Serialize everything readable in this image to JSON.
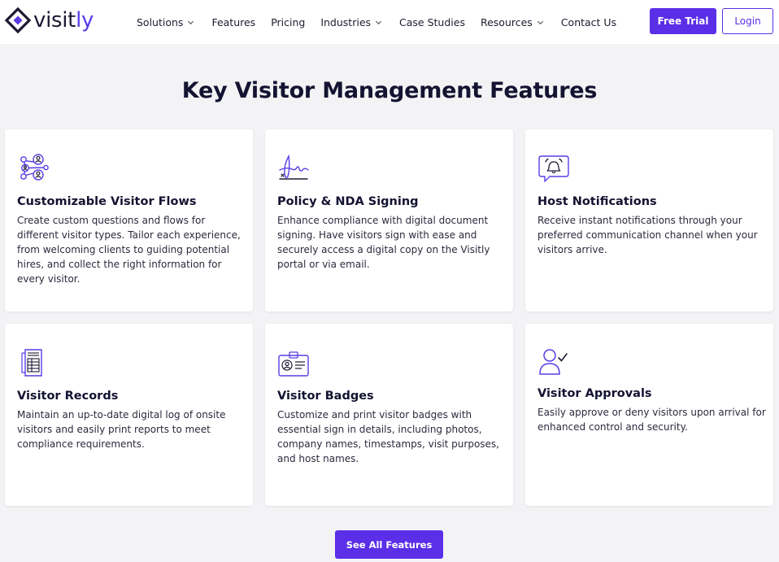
{
  "brand": {
    "name_prefix": "visit",
    "name_accent": "ly",
    "accent_color": "#5b2ee8",
    "dark_color": "#1b1a33"
  },
  "nav": {
    "items": [
      {
        "label": "Solutions",
        "has_dropdown": true
      },
      {
        "label": "Features",
        "has_dropdown": false
      },
      {
        "label": "Pricing",
        "has_dropdown": false
      },
      {
        "label": "Industries",
        "has_dropdown": true
      },
      {
        "label": "Case Studies",
        "has_dropdown": false
      },
      {
        "label": "Resources",
        "has_dropdown": true
      },
      {
        "label": "Contact Us",
        "has_dropdown": false
      }
    ],
    "free_trial_label": "Free Trial",
    "login_label": "Login"
  },
  "section": {
    "title": "Key Visitor Management Features"
  },
  "features": [
    {
      "icon": "visitor-flows-icon",
      "title": "Customizable Visitor Flows",
      "description": "Create custom questions and flows for different visitor types. Tailor each experience, from welcoming clients to guiding potential hires, and collect the right information for every visitor."
    },
    {
      "icon": "signature-icon",
      "title": "Policy & NDA Signing",
      "description": "Enhance compliance with digital document signing. Have visitors sign with ease and securely access a digital copy on the Visitly portal or via email."
    },
    {
      "icon": "notification-bell-icon",
      "title": "Host Notifications",
      "description": "Receive instant notifications through your preferred communication channel when your visitors arrive."
    },
    {
      "icon": "document-log-icon",
      "title": "Visitor Records",
      "description": "Maintain an up-to-date digital log of onsite visitors and easily print reports to meet compliance requirements."
    },
    {
      "icon": "badge-icon",
      "title": "Visitor Badges",
      "description": "Customize and print visitor badges with essential sign in details, including photos, company names, timestamps, visit purposes, and host names."
    },
    {
      "icon": "user-check-icon",
      "title": "Visitor Approvals",
      "description": "Easily approve or deny visitors upon arrival for enhanced control and security."
    }
  ],
  "cta": {
    "see_all_label": "See All Features"
  }
}
